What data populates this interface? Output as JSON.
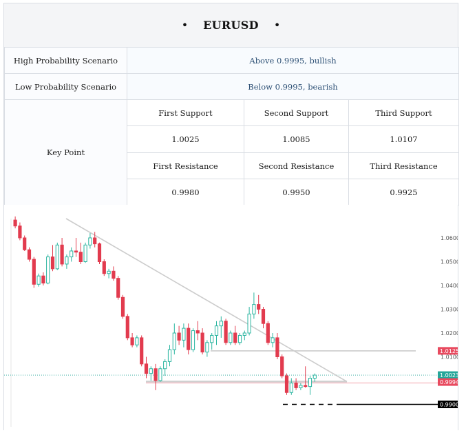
{
  "header": {
    "bullet_left": "•",
    "title": "EURUSD",
    "bullet_right": "•"
  },
  "scenarios": {
    "high_label": "High Probability Scenario",
    "high_value": "Above 0.9995, bullish",
    "low_label": "Low Probability Scenario",
    "low_value": "Below 0.9995, bearish"
  },
  "key_point": {
    "label": "Key Point",
    "support_headers": [
      "First Support",
      "Second Support",
      "Third Support"
    ],
    "support_values": [
      "1.0025",
      "1.0085",
      "1.0107"
    ],
    "resistance_headers": [
      "First Resistance",
      "Second Resistance",
      "Third Resistance"
    ],
    "resistance_values": [
      "0.9980",
      "0.9950",
      "0.9925"
    ]
  },
  "chart_data": {
    "type": "candlestick",
    "symbol": "EURUSD",
    "y_ticks": [
      "1.0600",
      "1.0500",
      "1.0400",
      "1.0300",
      "1.0200",
      "1.0100"
    ],
    "price_tags": [
      {
        "value": "1.0125",
        "color": "#e84a5f"
      },
      {
        "value": "1.0023",
        "color": "#26a69a"
      },
      {
        "value": "0.9994",
        "color": "#e84a5f"
      },
      {
        "value": "0.9900",
        "color": "#000000"
      }
    ],
    "colors": {
      "up": "#2bb5a0",
      "down": "#e23b4e"
    },
    "candles": [
      [
        1.0675,
        1.069,
        1.064,
        1.065
      ],
      [
        1.065,
        1.0665,
        1.059,
        1.06
      ],
      [
        1.06,
        1.061,
        1.0545,
        1.055
      ],
      [
        1.055,
        1.056,
        1.05,
        1.051
      ],
      [
        1.051,
        1.052,
        1.039,
        1.0405
      ],
      [
        1.0405,
        1.045,
        1.0395,
        1.044
      ],
      [
        1.044,
        1.0455,
        1.04,
        1.041
      ],
      [
        1.041,
        1.053,
        1.0405,
        1.052
      ],
      [
        1.052,
        1.057,
        1.046,
        1.047
      ],
      [
        1.047,
        1.058,
        1.0465,
        1.057
      ],
      [
        1.057,
        1.06,
        1.048,
        1.049
      ],
      [
        1.049,
        1.053,
        1.047,
        1.052
      ],
      [
        1.052,
        1.056,
        1.05,
        1.0545
      ],
      [
        1.0545,
        1.06,
        1.052,
        1.054
      ],
      [
        1.054,
        1.058,
        1.049,
        1.05
      ],
      [
        1.05,
        1.058,
        1.0495,
        1.057
      ],
      [
        1.057,
        1.062,
        1.0555,
        1.06
      ],
      [
        1.06,
        1.0625,
        1.056,
        1.0575
      ],
      [
        1.0575,
        1.058,
        1.049,
        1.05
      ],
      [
        1.05,
        1.051,
        1.044,
        1.045
      ],
      [
        1.045,
        1.047,
        1.043,
        1.046
      ],
      [
        1.046,
        1.048,
        1.042,
        1.043
      ],
      [
        1.043,
        1.044,
        1.034,
        1.035
      ],
      [
        1.035,
        1.036,
        1.026,
        1.027
      ],
      [
        1.027,
        1.028,
        1.017,
        1.018
      ],
      [
        1.018,
        1.02,
        1.014,
        1.015
      ],
      [
        1.015,
        1.019,
        1.014,
        1.018
      ],
      [
        1.018,
        1.019,
        1.006,
        1.007
      ],
      [
        1.007,
        1.01,
        1.001,
        1.003
      ],
      [
        1.003,
        1.006,
        1.0,
        1.005
      ],
      [
        1.005,
        1.007,
        0.996,
        1.0
      ],
      [
        1.0,
        1.006,
        0.9995,
        1.005
      ],
      [
        1.005,
        1.009,
        1.002,
        1.008
      ],
      [
        1.008,
        1.015,
        1.006,
        1.013
      ],
      [
        1.013,
        1.024,
        1.011,
        1.02
      ],
      [
        1.02,
        1.023,
        1.015,
        1.017
      ],
      [
        1.017,
        1.024,
        1.014,
        1.022
      ],
      [
        1.022,
        1.024,
        1.011,
        1.013
      ],
      [
        1.013,
        1.022,
        1.012,
        1.021
      ],
      [
        1.021,
        1.025,
        1.017,
        1.02
      ],
      [
        1.02,
        1.022,
        1.011,
        1.012
      ],
      [
        1.012,
        1.017,
        1.01,
        1.016
      ],
      [
        1.016,
        1.02,
        1.013,
        1.019
      ],
      [
        1.019,
        1.025,
        1.015,
        1.023
      ],
      [
        1.023,
        1.027,
        1.018,
        1.025
      ],
      [
        1.025,
        1.026,
        1.015,
        1.016
      ],
      [
        1.016,
        1.021,
        1.015,
        1.02
      ],
      [
        1.02,
        1.023,
        1.015,
        1.016
      ],
      [
        1.016,
        1.02,
        1.015,
        1.019
      ],
      [
        1.019,
        1.021,
        1.017,
        1.02
      ],
      [
        1.02,
        1.031,
        1.019,
        1.028
      ],
      [
        1.028,
        1.037,
        1.026,
        1.032
      ],
      [
        1.032,
        1.036,
        1.028,
        1.03
      ],
      [
        1.03,
        1.031,
        1.022,
        1.024
      ],
      [
        1.024,
        1.025,
        1.015,
        1.016
      ],
      [
        1.016,
        1.02,
        1.014,
        1.018
      ],
      [
        1.018,
        1.02,
        1.009,
        1.01
      ],
      [
        1.01,
        1.011,
        1.001,
        1.002
      ],
      [
        1.002,
        1.003,
        0.994,
        0.995
      ],
      [
        0.995,
        1.001,
        0.994,
        0.999
      ],
      [
        0.999,
        1.001,
        0.996,
        0.997
      ],
      [
        0.997,
        0.999,
        0.996,
        0.998
      ],
      [
        0.998,
        1.006,
        0.997,
        0.9975
      ],
      [
        0.9975,
        1.002,
        0.994,
        1.001
      ],
      [
        1.001,
        1.003,
        0.9995,
        1.0023
      ]
    ]
  }
}
